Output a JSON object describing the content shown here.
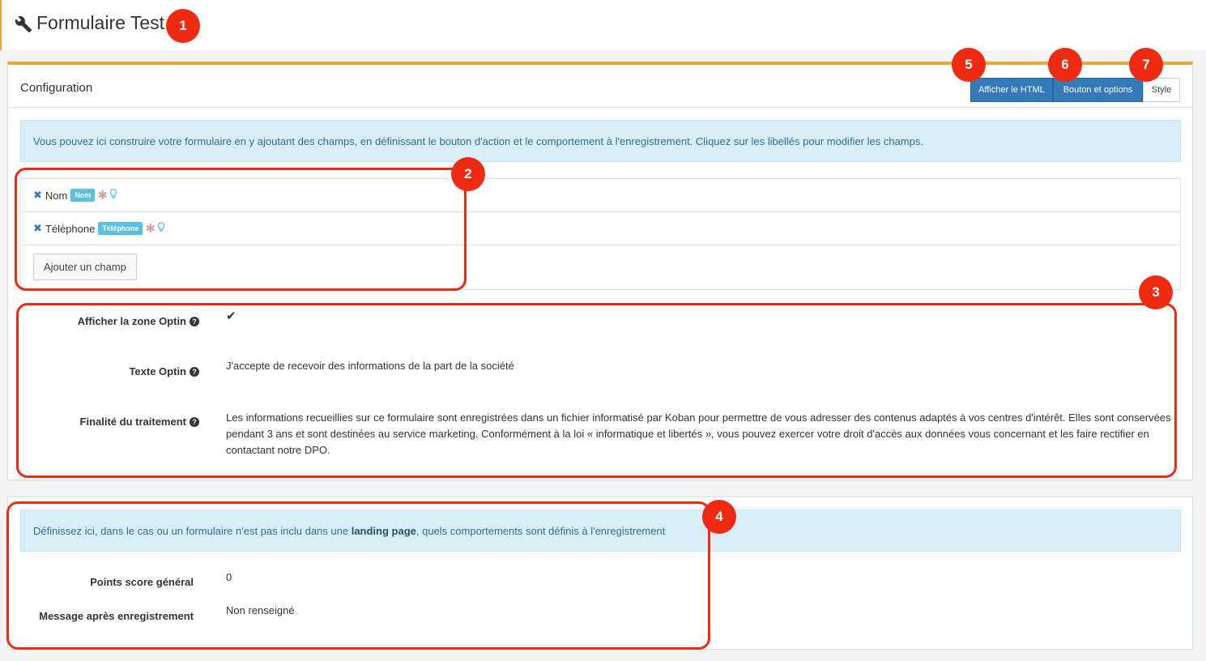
{
  "header": {
    "icon": "wrench-icon",
    "title": "Formulaire Test"
  },
  "panel": {
    "title": "Configuration",
    "buttons": {
      "html": "Afficher le HTML",
      "options": "Bouton et options",
      "style": "Style"
    },
    "info": "Vous pouvez ici construire votre formulaire en y ajoutant des champs, en définissant le bouton d'action et le comportement à l'enregistrement. Cliquez sur les libellés pour modifier les champs.",
    "fields": [
      {
        "label": "Nom",
        "tag": "Nom"
      },
      {
        "label": "Téléphone",
        "tag": "Téléphone"
      }
    ],
    "add_field": "Ajouter un champ",
    "optin": {
      "show_label": "Afficher la zone Optin",
      "show_value": "✔",
      "text_label": "Texte Optin",
      "text_value": "J'accepte de recevoir des informations de la part de la société",
      "purpose_label": "Finalité du traitement",
      "purpose_value": "Les informations recueillies sur ce formulaire sont enregistrées dans un fichier informatisé par Koban pour permettre de vous adresser des contenus adaptés à vos centres d'intérêt. Elles sont conservées pendant 3 ans et sont destinées au service marketing. Conformément à la loi « informatique et libertés », vous pouvez exercer votre droit d'accès aux données vous concernant et les faire rectifier en contactant notre DPO."
    }
  },
  "behavior": {
    "info_pre": "Définissez ici, dans le cas ou un formulaire n'est pas inclu dans une ",
    "info_bold": "landing page",
    "info_post": ", quels comportements sont définis à l'enregistrement",
    "score_label": "Points score général",
    "score_value": "0",
    "message_label": "Message après enregistrement",
    "message_value": "Non renseigné"
  },
  "annotations": [
    "1",
    "2",
    "3",
    "4",
    "5",
    "6",
    "7"
  ],
  "colors": {
    "accent": "#e9a53c",
    "primary": "#337ab7",
    "info_bg": "#d9edf7",
    "annotation": "#ee2b12"
  }
}
